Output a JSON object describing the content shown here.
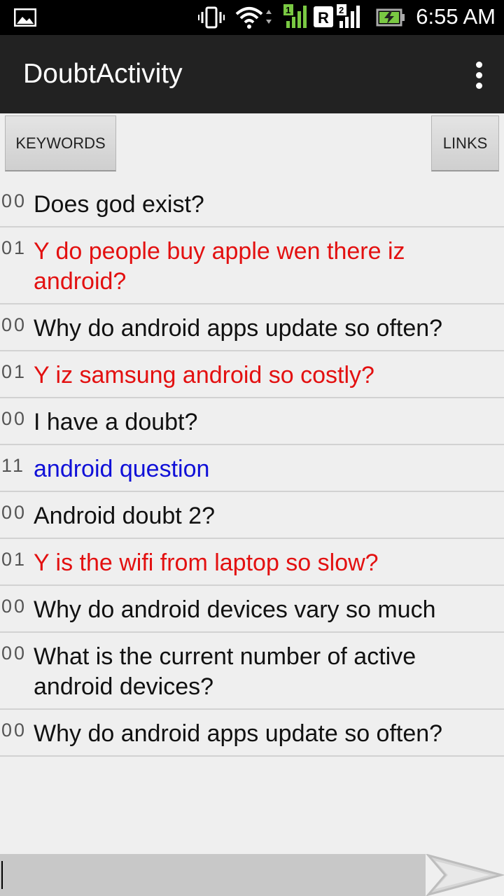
{
  "status_bar": {
    "time": "6:55 AM",
    "icons": [
      "gallery-icon",
      "vibrate-icon",
      "wifi-icon",
      "signal-sim1-icon",
      "roaming-icon",
      "signal-sim2-icon",
      "battery-charging-icon"
    ],
    "sim1_label": "1",
    "roaming_label": "R",
    "sim2_label": "2"
  },
  "action_bar": {
    "title": "DoubtActivity",
    "overflow_icon": "overflow-menu-icon"
  },
  "buttons": {
    "keywords": "KEYWORDS",
    "links": "LINKS"
  },
  "colors": {
    "normal": "#111111",
    "red": "#e31010",
    "blue": "#1010d8"
  },
  "doubts": [
    {
      "code": "00",
      "text": "Does god exist?",
      "color": "#111111"
    },
    {
      "code": "01",
      "text": "Y do people buy apple wen there iz android?",
      "color": "#e31010"
    },
    {
      "code": "00",
      "text": "Why do android apps update so often?",
      "color": "#111111"
    },
    {
      "code": "01",
      "text": "Y iz samsung android so costly?",
      "color": "#e31010"
    },
    {
      "code": "00",
      "text": "I have a doubt?",
      "color": "#111111"
    },
    {
      "code": "11",
      "text": "android question",
      "color": "#1010d8"
    },
    {
      "code": "00",
      "text": "Android doubt 2?",
      "color": "#111111"
    },
    {
      "code": "01",
      "text": "Y is the wifi from laptop so slow?",
      "color": "#e31010"
    },
    {
      "code": "00",
      "text": "Why do android devices vary so much",
      "color": "#111111"
    },
    {
      "code": "00",
      "text": "What is the current number of active android devices?",
      "color": "#111111"
    },
    {
      "code": "00",
      "text": "Why do android apps update so often?",
      "color": "#111111"
    }
  ],
  "composer": {
    "input_value": "",
    "send_icon": "send-arrow-icon"
  }
}
